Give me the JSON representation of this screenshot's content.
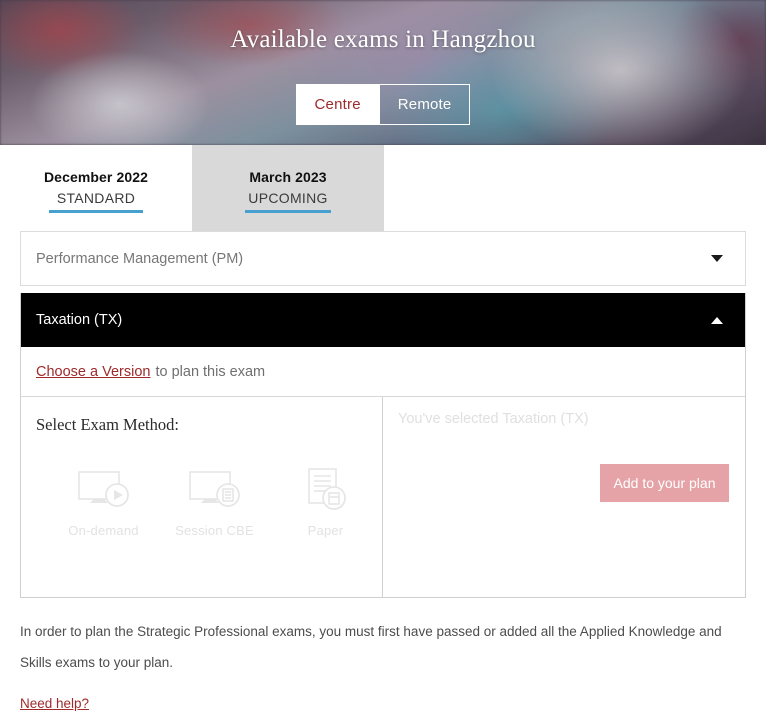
{
  "hero": {
    "title": "Available exams in Hangzhou",
    "toggle": [
      {
        "label": "Centre",
        "state": "active"
      },
      {
        "label": "Remote",
        "state": "inactive"
      }
    ],
    "accent_active_text": "#9e2a2b"
  },
  "tabs": [
    {
      "title": "December 2022",
      "subtitle": "STANDARD",
      "selected": false,
      "underline_color": "#46a0d0"
    },
    {
      "title": "March 2023",
      "subtitle": "UPCOMING",
      "selected": true,
      "underline_color": "#46a0d0"
    }
  ],
  "exams": [
    {
      "name": "Performance Management (PM)",
      "expanded": false,
      "caret": "chevron-down-icon"
    }
  ],
  "accordion": {
    "title": "Taxation (TX)",
    "caret": "chevron-up-icon",
    "version_link": "Choose a Version",
    "version_rest": "to plan this exam",
    "method_title": "Select Exam Method:",
    "methods": [
      {
        "label": "On-demand",
        "icon": "monitor-play-icon"
      },
      {
        "label": "Session CBE",
        "icon": "monitor-document-icon"
      },
      {
        "label": "Paper",
        "icon": "paper-document-icon"
      }
    ],
    "selection_text": "You've selected Taxation (TX)",
    "add_button": "Add to your plan",
    "add_button_color": "#e5a3a8"
  },
  "footer": {
    "note": "In order to plan the Strategic Professional exams, you must first have passed or added all the Applied Knowledge and Skills exams to your plan.",
    "help_link": "Need help?"
  }
}
